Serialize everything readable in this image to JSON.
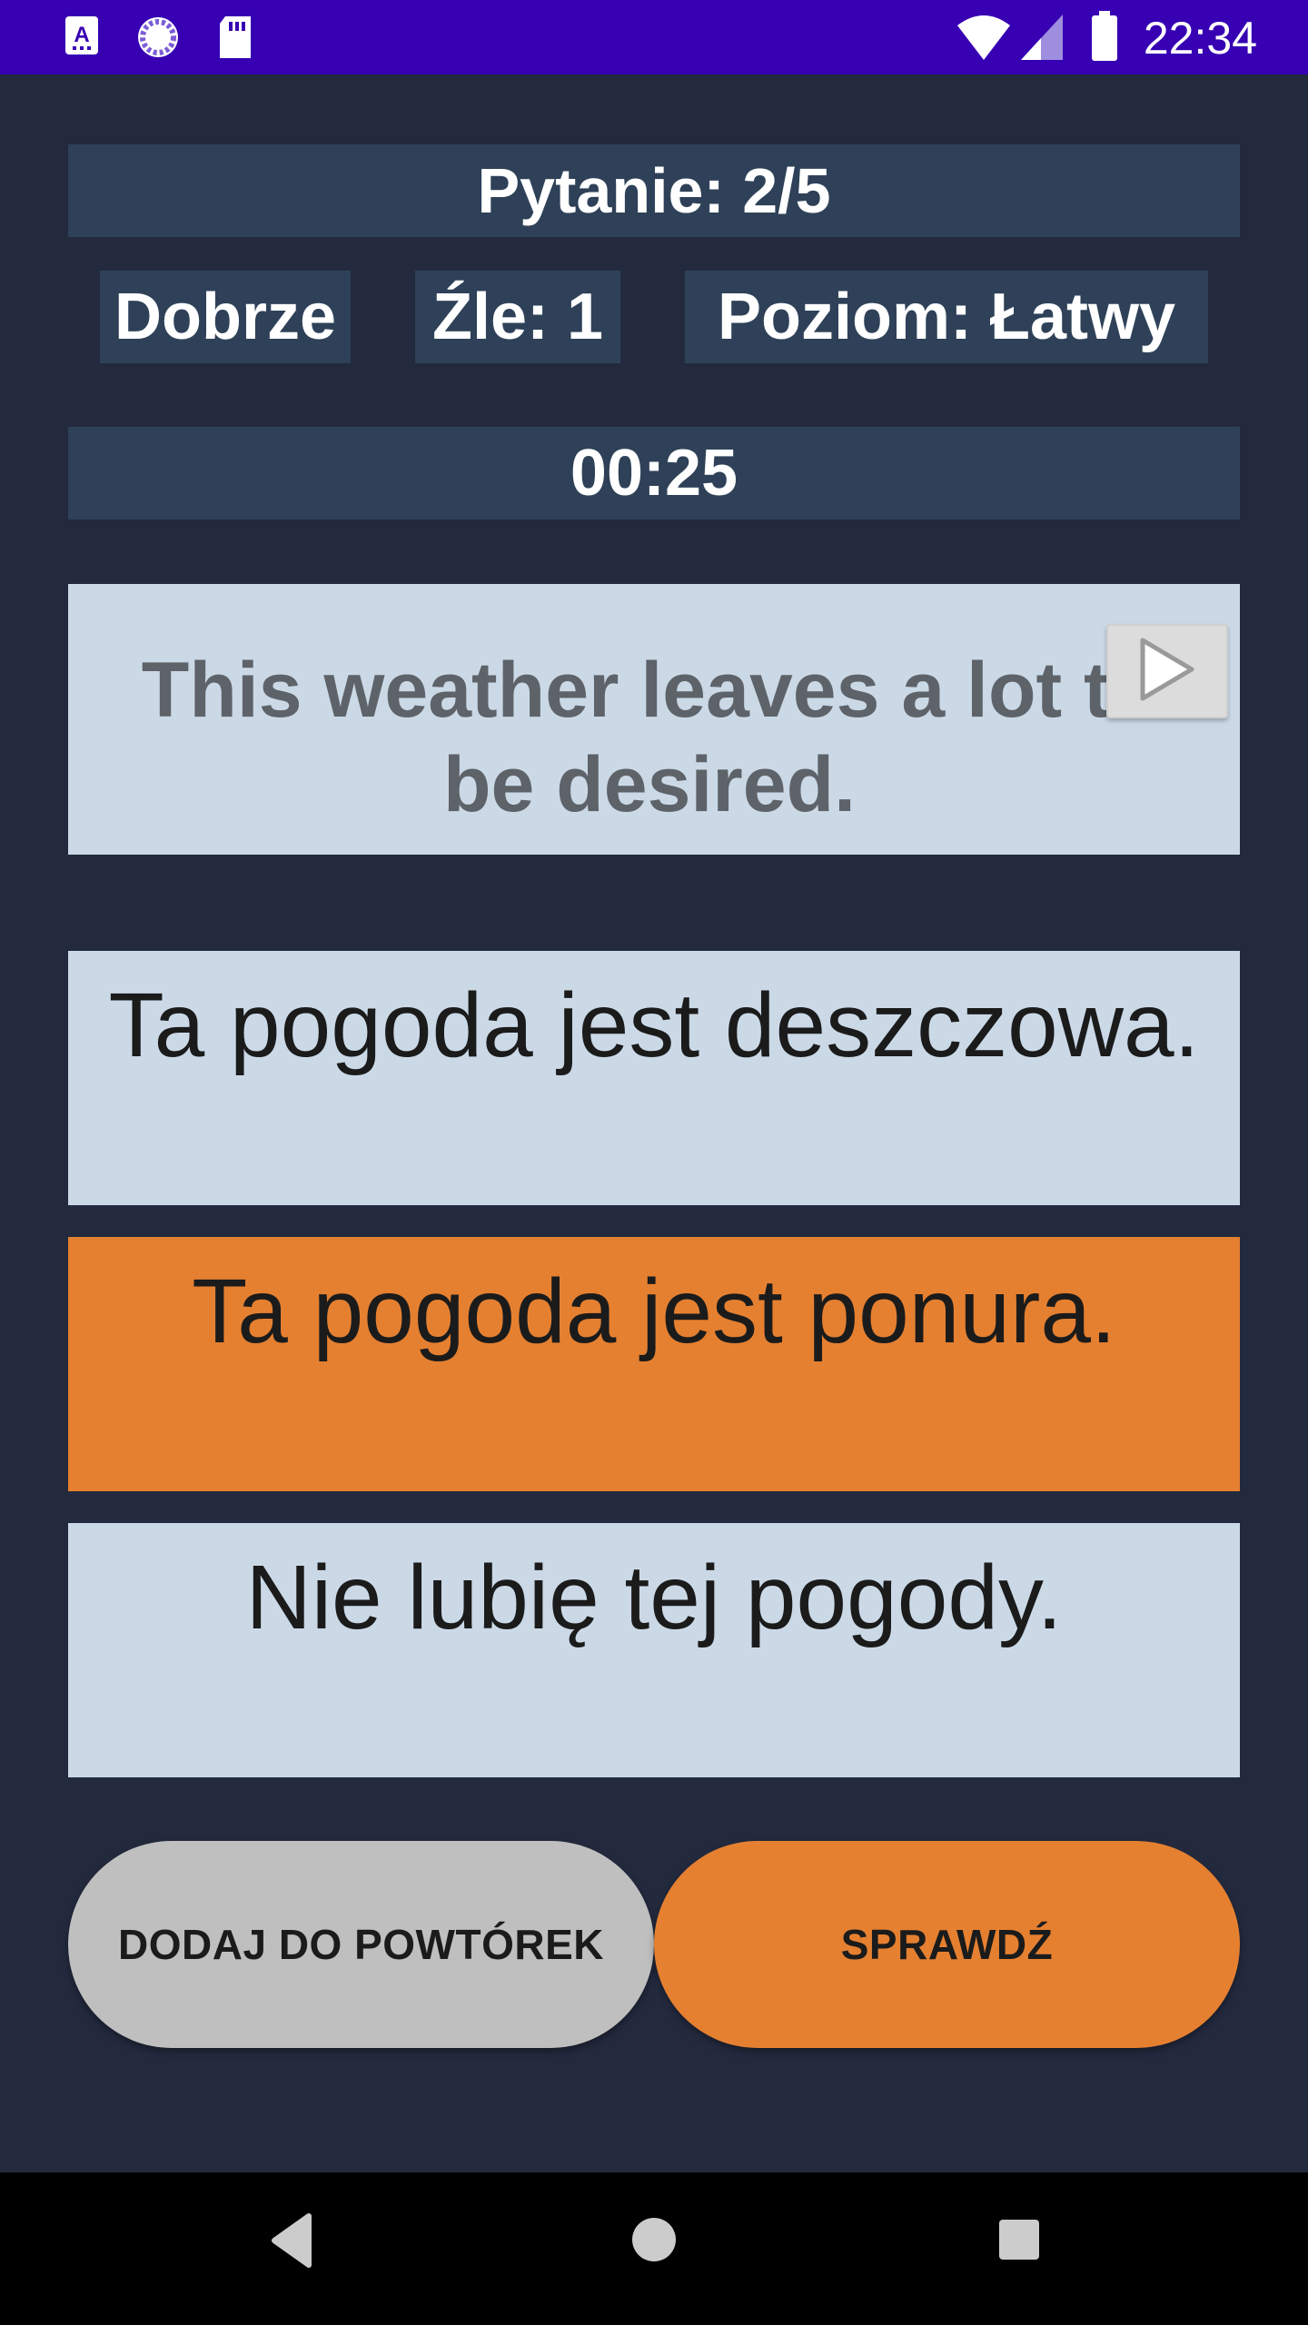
{
  "status_bar": {
    "time": "22:34",
    "icons": [
      "font-icon",
      "sync-icon",
      "sd-card-icon",
      "wifi-icon",
      "signal-icon",
      "battery-icon"
    ]
  },
  "quiz": {
    "question_label": "Pytanie: 2/5",
    "correct_label": "Dobrze",
    "wrong_label": "Źle: 1",
    "level_label": "Poziom: Łatwy",
    "timer": "00:25"
  },
  "prompt": {
    "text": "This weather leaves a lot to be desired.",
    "play_icon": "play-icon"
  },
  "answers": [
    {
      "text": "Ta pogoda jest deszczowa.",
      "selected": false
    },
    {
      "text": "Ta pogoda jest ponura.",
      "selected": true
    },
    {
      "text": "Nie lubię tej pogody.",
      "selected": false
    }
  ],
  "buttons": {
    "review_label": "DODAJ DO POWTÓREK",
    "check_label": "SPRAWDŹ"
  },
  "nav_bar": {
    "icons": [
      "back-icon",
      "home-icon",
      "recents-icon"
    ]
  },
  "colors": {
    "background": "#232a3e",
    "status_bar": "#3700b3",
    "info_bar": "#2e4158",
    "card": "#cbd9e7",
    "accent": "#e58031",
    "secondary_button": "#bfbfbf"
  }
}
